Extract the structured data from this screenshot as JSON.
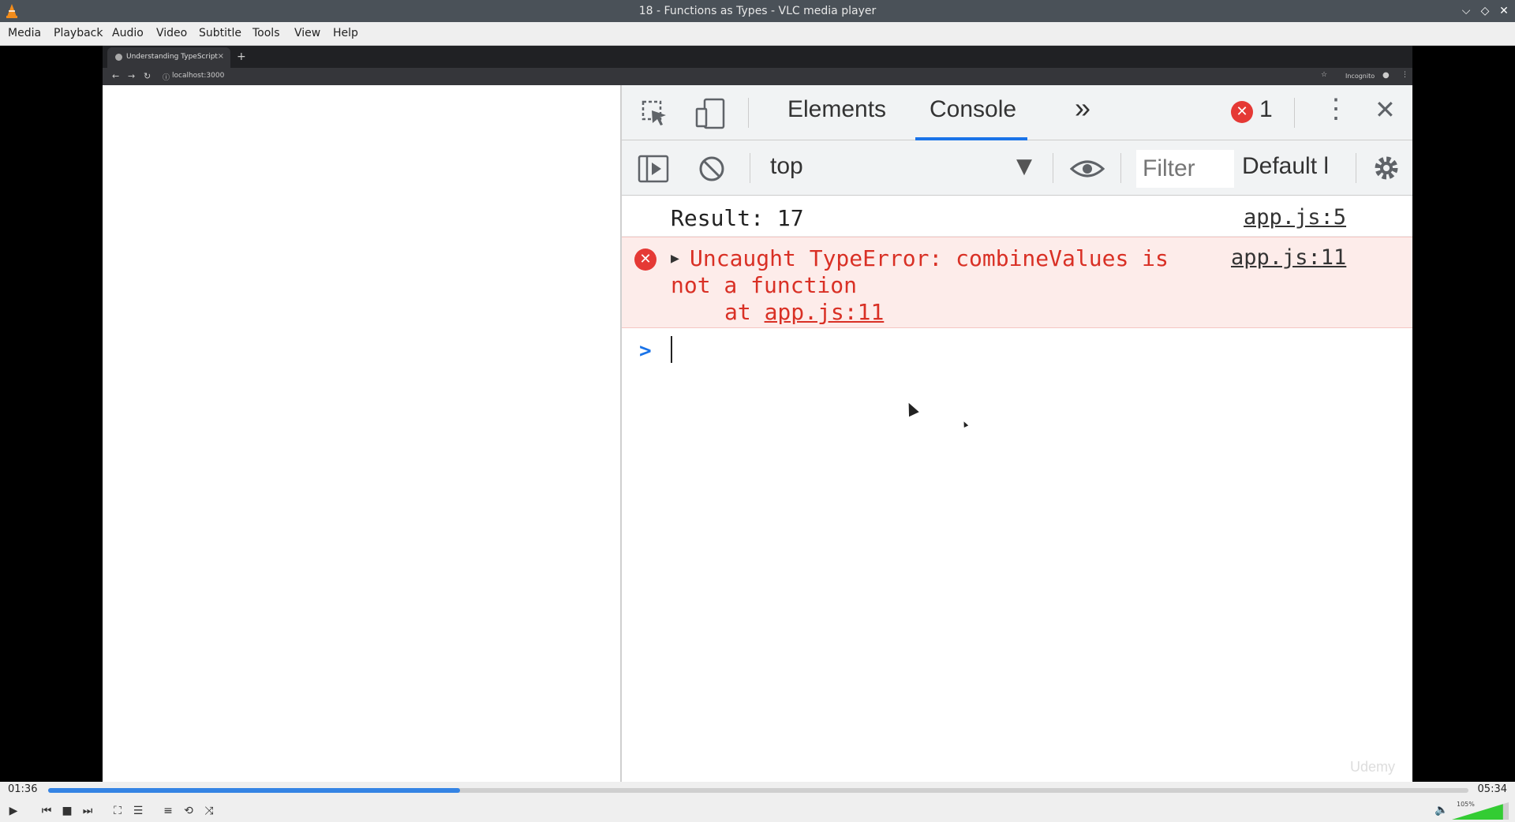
{
  "window": {
    "title": "18 - Functions as Types - VLC media player",
    "controls": [
      "⌵",
      "◇",
      "✕"
    ]
  },
  "menu": [
    "Media",
    "Playback",
    "Audio",
    "Video",
    "Subtitle",
    "Tools",
    "View",
    "Help"
  ],
  "browser": {
    "tab_title": "Understanding TypeScript",
    "tab_close": "×",
    "new_tab": "+",
    "nav": [
      "←",
      "→",
      "↻"
    ],
    "url": "localhost:3000",
    "bookmark_icon": "☆",
    "incognito_label": "Incognito",
    "menu_dots": "⋮"
  },
  "devtools": {
    "tabs": {
      "elements": "Elements",
      "console": "Console",
      "more": "»"
    },
    "error_count": "1",
    "close": "✕",
    "menu_dots": "⋮",
    "context": "top",
    "context_arrow": "▼",
    "filter_placeholder": "Filter",
    "levels": "Default l",
    "console": {
      "log": {
        "message": "Result: 17",
        "source": "app.js:5"
      },
      "error": {
        "line1": "Uncaught TypeError: combineValues is",
        "line2": "not a function",
        "line3_prefix": "at ",
        "line3_link": "app.js:11",
        "source": "app.js:11"
      },
      "prompt": ">"
    },
    "watermark": "Udemy"
  },
  "player": {
    "time_elapsed": "01:36",
    "time_total": "05:34",
    "progress_fraction": 0.29,
    "volume_label": "105%",
    "volume_fraction": 0.9
  },
  "colors": {
    "accent": "#1a73e8",
    "error": "#d93025",
    "seek": "#3584e4",
    "volume": "#33cc33"
  }
}
